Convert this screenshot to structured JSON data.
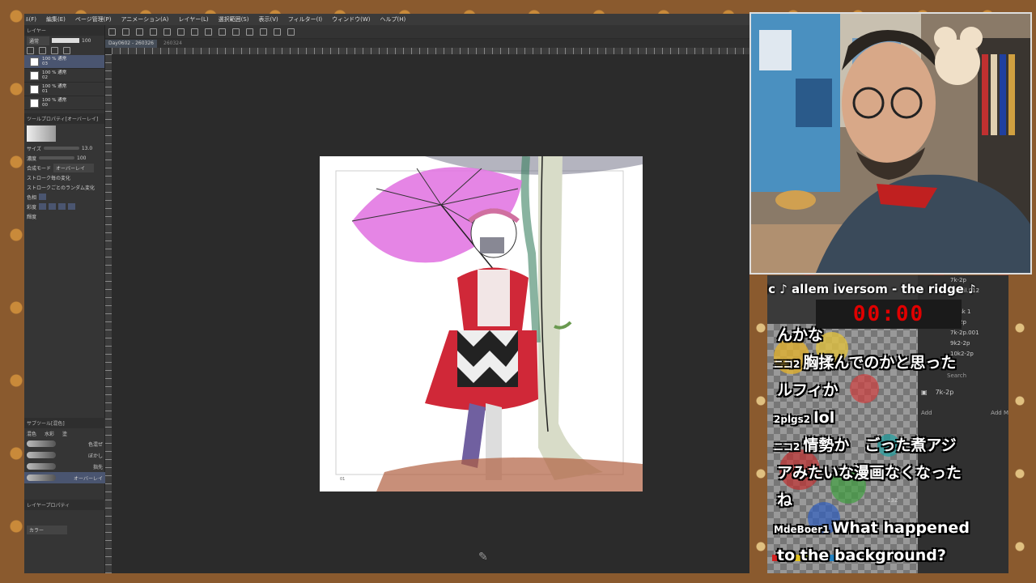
{
  "app": {
    "menu": [
      "ﾙ(F)",
      "編集(E)",
      "ページ管理(P)",
      "アニメーション(A)",
      "レイヤー(L)",
      "選択範囲(S)",
      "表示(V)",
      "フィルター(I)",
      "ウィンドウ(W)",
      "ヘルプ(H)"
    ],
    "tabs": [
      "Day0602 - 260326",
      "260324"
    ],
    "layer_panel": {
      "title": "レイヤー",
      "blend_mode": "通常",
      "opacity": "100",
      "layers": [
        {
          "line1": "100 % 通常",
          "line2": "03"
        },
        {
          "line1": "100 % 通常",
          "line2": "02"
        },
        {
          "line1": "100 % 通常",
          "line2": "01"
        },
        {
          "line1": "100 % 通常",
          "line2": "00"
        }
      ],
      "tool_property_title": "ツールプロパティ[オーバーレイ]",
      "size_label": "サイズ",
      "size_value": "13.0",
      "density_label": "濃度",
      "density_value": "100",
      "mode_label": "合成モード",
      "mode_value": "オーバーレイ",
      "stroke_change": "ストローク毎の変化",
      "stroke_random": "ストロークごとのランダム変化",
      "hue_label": "色相",
      "sat_label": "彩度",
      "val_label": "輝度"
    },
    "subtool": {
      "title": "サブツール[混色]",
      "tabs": [
        "混色",
        "水彩",
        "塗"
      ],
      "items": [
        "色混ぜ",
        "ぼかし",
        "指先",
        "オーバーレイ"
      ],
      "property_title": "レイヤープロパティ",
      "color_label": "カラー"
    }
  },
  "overlay": {
    "music": "ic ♪ allem iversom - the ridge ♪",
    "timer": "00:00",
    "panel_rows": [
      "7k-2p",
      "Pencil.012",
      "sea",
      "mask 1",
      "9k-2p",
      "7k-2p.001",
      "9k2-2p",
      "10k2-2p"
    ],
    "search_placeholder": "Search",
    "layer_label": "7k-2p",
    "add_label": "Add",
    "add_modifier": "Add M",
    "grid_number": "132"
  },
  "chat": [
    {
      "name": "",
      "text": "んかな",
      "avatar": ""
    },
    {
      "name": "ニコ2",
      "text": "胸揉んでのかと思った",
      "avatar": "#3a80c0"
    },
    {
      "name": "",
      "text": "ルフィか",
      "avatar": ""
    },
    {
      "name": "2plgs2",
      "text": "lol",
      "avatar": "#30a050"
    },
    {
      "name": "ニコ2",
      "text": "情勢か　ごった煮アジ",
      "avatar": "#3a80c0"
    },
    {
      "name": "",
      "text": "アみたいな漫画なくなった",
      "avatar": ""
    },
    {
      "name": "",
      "text": "ね",
      "avatar": ""
    },
    {
      "name": "MdeBoer1",
      "text": "What happened",
      "avatar": "#d04080"
    },
    {
      "name": "",
      "text": "to the background?",
      "avatar": ""
    }
  ],
  "colors": {
    "accent": "#4a5570",
    "timer": "#e00000",
    "umbrella": "#e070e0",
    "dress": "#d02838"
  }
}
